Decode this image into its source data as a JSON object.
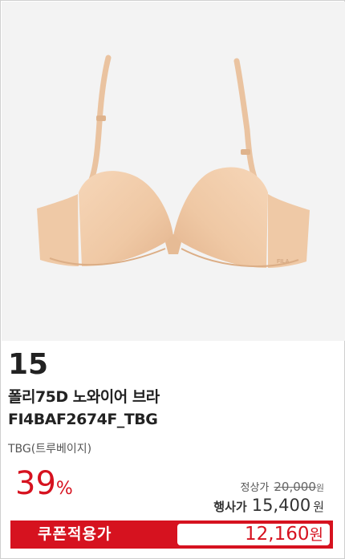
{
  "product": {
    "rank": "15",
    "name": "폴리75D 노와이어 브라",
    "code": "FI4BAF2674F_TBG",
    "color": "TBG(트루베이지)",
    "image_subject": "bra-image",
    "brand_mark": "FILA"
  },
  "pricing": {
    "discount_number": "39",
    "discount_symbol": "%",
    "regular_label": "정상가",
    "regular_price": "20,000",
    "regular_unit": "원",
    "event_label": "행사가",
    "event_price": "15,400",
    "event_unit": "원"
  },
  "coupon": {
    "label": "쿠폰적용가",
    "price": "12,160",
    "unit": "원"
  },
  "colors": {
    "accent": "#d6121f",
    "image_background": "#f3f3f3",
    "product_tone": "#f0c9a6"
  }
}
